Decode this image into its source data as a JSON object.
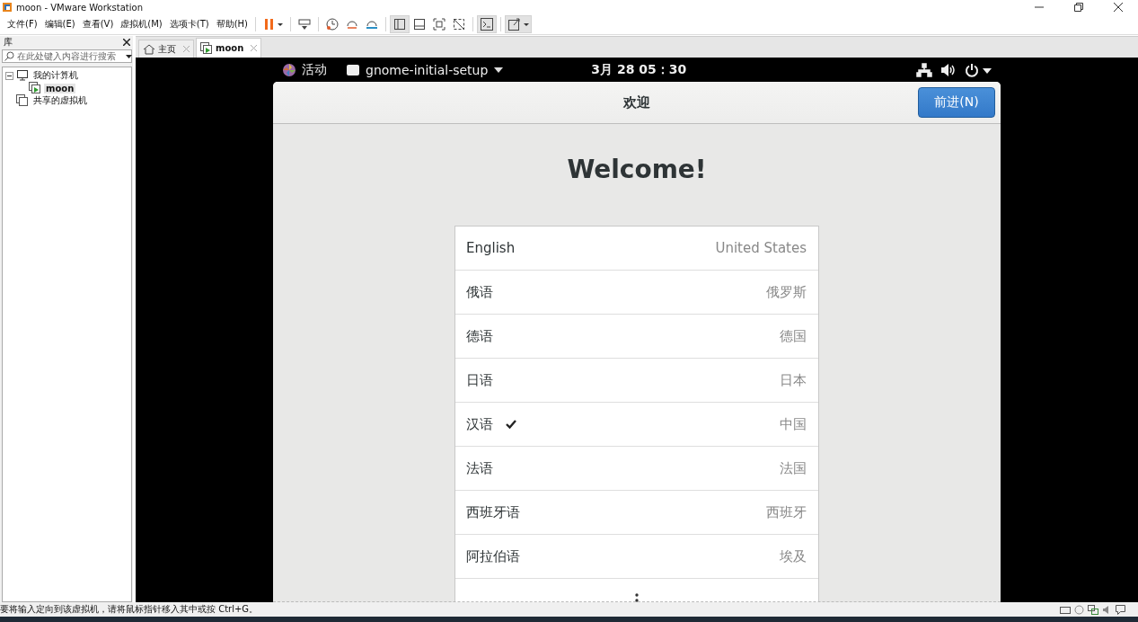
{
  "window": {
    "title": "moon - VMware Workstation"
  },
  "menu": [
    "文件(F)",
    "编辑(E)",
    "查看(V)",
    "虚拟机(M)",
    "选项卡(T)",
    "帮助(H)"
  ],
  "toolbar": [
    {
      "kind": "pause"
    },
    {
      "kind": "send"
    },
    {
      "kind": "snapshot"
    },
    {
      "kind": "revert"
    },
    {
      "kind": "manager"
    },
    {
      "kind": "sidebar",
      "selected": true
    },
    {
      "kind": "thumb",
      "selected": false
    },
    {
      "kind": "full",
      "selected": false
    },
    {
      "kind": "unity",
      "selected": false
    },
    {
      "kind": "console",
      "selected": true
    },
    {
      "kind": "stretch",
      "selected": true
    }
  ],
  "library": {
    "title": "库",
    "search": {
      "placeholder": "在此处键入内容进行搜索"
    },
    "tree": [
      {
        "label": "我的计算机",
        "kind": "computer",
        "expanded": true,
        "selected": false,
        "children": [
          {
            "label": "moon",
            "kind": "vm",
            "selected": true
          }
        ]
      },
      {
        "label": "共享的虚拟机",
        "kind": "shared",
        "selected": false
      }
    ]
  },
  "tabs": [
    {
      "label": "主页",
      "kind": "home",
      "selected": false
    },
    {
      "label": "moon",
      "kind": "vm",
      "selected": true
    }
  ],
  "guest": {
    "topbar": {
      "activities": "活动",
      "app": "gnome-initial-setup",
      "clock": "3月 28  05：30"
    },
    "header": {
      "title": "欢迎",
      "next_button": "前进(N)"
    },
    "heading": "Welcome!",
    "languages": [
      {
        "name": "English",
        "region": "United States",
        "selected": false
      },
      {
        "name": "俄语",
        "region": "俄罗斯",
        "selected": false
      },
      {
        "name": "德语",
        "region": "德国",
        "selected": false
      },
      {
        "name": "日语",
        "region": "日本",
        "selected": false
      },
      {
        "name": "汉语",
        "region": "中国",
        "selected": true
      },
      {
        "name": "法语",
        "region": "法国",
        "selected": false
      },
      {
        "name": "西班牙语",
        "region": "西班牙",
        "selected": false
      },
      {
        "name": "阿拉伯语",
        "region": "埃及",
        "selected": false
      }
    ]
  },
  "status_bar": {
    "text": "要将输入定向到该虚拟机，请将鼠标指针移入其中或按 Ctrl+G。"
  }
}
